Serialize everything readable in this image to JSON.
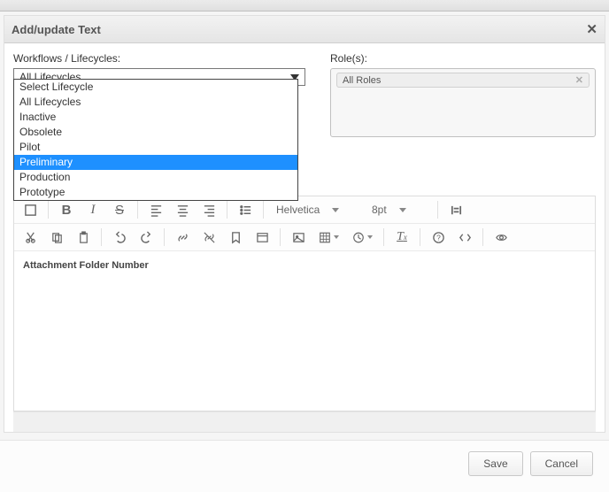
{
  "dialog": {
    "title": "Add/update Text",
    "close_glyph": "✕"
  },
  "workflows": {
    "label": "Workflows / Lifecycles:",
    "selected": "All Lifecycles",
    "options": [
      "Select Lifecycle",
      "All Lifecycles",
      "Inactive",
      "Obsolete",
      "Pilot",
      "Preliminary",
      "Production",
      "Prototype"
    ],
    "highlighted_index": 5
  },
  "roles": {
    "label": "Role(s):",
    "items": [
      "All Roles"
    ]
  },
  "toolbar": {
    "row1": [
      {
        "name": "checkbox-icon"
      },
      {
        "name": "bold-icon",
        "char": "B"
      },
      {
        "name": "italic-icon",
        "char": "I"
      },
      {
        "name": "strike-icon",
        "char": "S"
      },
      {
        "name": "align-left-icon"
      },
      {
        "name": "align-center-icon"
      },
      {
        "name": "align-right-icon"
      },
      {
        "name": "unordered-list-icon"
      }
    ],
    "font_name": "Helvetica",
    "font_size": "8pt",
    "row2": [
      {
        "name": "cut-icon"
      },
      {
        "name": "copy-icon"
      },
      {
        "name": "paste-icon"
      },
      {
        "name": "undo-icon"
      },
      {
        "name": "redo-icon"
      },
      {
        "name": "link-icon"
      },
      {
        "name": "unlink-icon"
      },
      {
        "name": "bookmark-icon"
      },
      {
        "name": "code-block-icon"
      },
      {
        "name": "image-icon"
      },
      {
        "name": "table-icon"
      },
      {
        "name": "clock-icon"
      },
      {
        "name": "clear-format-icon"
      },
      {
        "name": "help-icon"
      },
      {
        "name": "source-icon"
      },
      {
        "name": "preview-icon"
      }
    ]
  },
  "content": {
    "text": "Attachment Folder Number"
  },
  "buttons": {
    "save": "Save",
    "cancel": "Cancel"
  }
}
